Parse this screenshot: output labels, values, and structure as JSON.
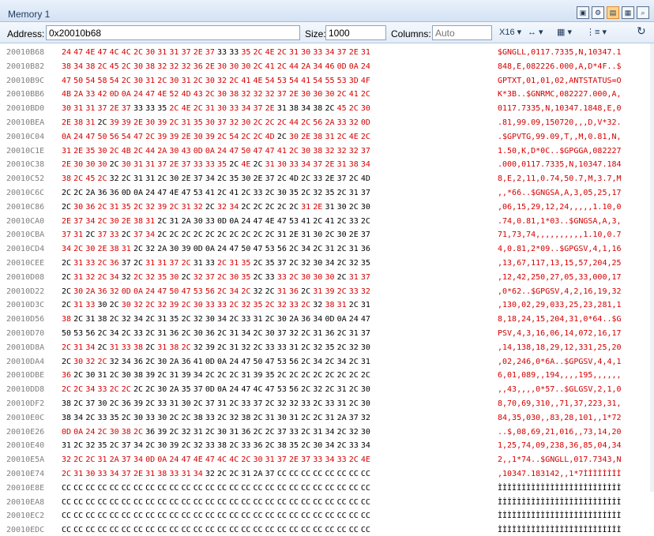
{
  "window": {
    "title": "Memory 1"
  },
  "toolbar": {
    "address_label": "Address:",
    "address_value": "0x20010b68",
    "size_label": "Size:",
    "size_value": "1000",
    "columns_label": "Columns:",
    "columns_placeholder": "Auto",
    "format_label": "X16",
    "colors": {
      "changed": "#d40000",
      "unchanged": "#000000",
      "address": "#808080",
      "active_icon": "#ffd38a"
    }
  },
  "memory": {
    "rows": [
      {
        "address": "20010B68",
        "hex": "24 47 4E 47 4C 4C 2C 30 31 31 37 2E 37 33 33 35 2C 4E 2C 31 30 33 34 37 2E 31",
        "ascii": "$GNGLL,0117.7335,N,10347.1",
        "black": [
          13,
          14
        ]
      },
      {
        "address": "20010B82",
        "hex": "38 34 38 2C 45 2C 30 38 32 32 32 36 2E 30 30 30 2C 41 2C 44 2A 34 46 0D 0A 24",
        "ascii": "848,E,082226.000,A,D*4F..$",
        "black": []
      },
      {
        "address": "20010B9C",
        "hex": "47 50 54 58 54 2C 30 31 2C 30 31 2C 30 32 2C 41 4E 54 53 54 41 54 55 53 3D 4F",
        "ascii": "GPTXT,01,01,02,ANTSTATUS=O",
        "black": []
      },
      {
        "address": "20010BB6",
        "hex": "4B 2A 33 42 0D 0A 24 47 4E 52 4D 43 2C 30 38 32 32 32 37 2E 30 30 30 2C 41 2C",
        "ascii": "K*3B..$GNRMC,082227.000,A,",
        "black": []
      },
      {
        "address": "20010BD0",
        "hex": "30 31 31 37 2E 37 33 33 35 2C 4E 2C 31 30 33 34 37 2E 31 38 34 38 2C 45 2C 30",
        "ascii": "0117.7335,N,10347.1848,E,0",
        "black": [
          6,
          7,
          8,
          18,
          19,
          20,
          21,
          22
        ]
      },
      {
        "address": "20010BEA",
        "hex": "2E 38 31 2C 39 39 2E 30 39 2C 31 35 30 37 32 30 2C 2C 2C 44 2C 56 2A 33 32 0D",
        "ascii": ".81,99.09,150720,,,D,V*32.",
        "black": [
          3
        ]
      },
      {
        "address": "20010C04",
        "hex": "0A 24 47 50 56 54 47 2C 39 39 2E 30 39 2C 54 2C 2C 4D 2C 30 2E 38 31 2C 4E 2C",
        "ascii": ".$GPVTG,99.09,T,,M,0.81,N,",
        "black": [
          18
        ]
      },
      {
        "address": "20010C1E",
        "hex": "31 2E 35 30 2C 4B 2C 44 2A 30 43 0D 0A 24 47 50 47 47 41 2C 30 38 32 32 32 37",
        "ascii": "1.50,K,D*0C..$GPGGA,082227",
        "black": []
      },
      {
        "address": "20010C38",
        "hex": "2E 30 30 30 2C 30 31 31 37 2E 37 33 33 35 2C 4E 2C 31 30 33 34 37 2E 31 38 34",
        "ascii": ".000,0117.7335,N,10347.184",
        "black": [
          4,
          14,
          16
        ]
      },
      {
        "address": "20010C52",
        "hex": "38 2C 45 2C 32 2C 31 31 2C 30 2E 37 34 2C 35 30 2E 37 2C 4D 2C 33 2E 37 2C 4D",
        "ascii": "8,E,2,11,0.74,50.7,M,3.7,M",
        "black": [
          4,
          5,
          6,
          7,
          8,
          9,
          10,
          11,
          12,
          13,
          14,
          15,
          16,
          17,
          18,
          19,
          20,
          21,
          22,
          23,
          24,
          25
        ]
      },
      {
        "address": "20010C6C",
        "hex": "2C 2C 2A 36 36 0D 0A 24 47 4E 47 53 41 2C 41 2C 33 2C 30 35 2C 32 35 2C 31 37",
        "ascii": ",,*66..$GNGSA,A,3,05,25,17",
        "black": [
          0,
          1,
          2,
          3,
          4,
          5,
          6,
          7,
          8,
          9,
          10,
          11,
          12,
          13,
          14,
          15,
          16,
          17,
          18,
          19,
          20,
          21,
          22,
          23,
          24,
          25
        ]
      },
      {
        "address": "20010C86",
        "hex": "2C 30 36 2C 31 35 2C 32 39 2C 31 32 2C 32 34 2C 2C 2C 2C 2C 31 2E 31 30 2C 30",
        "ascii": ",06,15,29,12,24,,,,,1.10,0",
        "black": [
          0,
          12,
          15,
          16,
          17,
          18,
          19,
          22,
          23,
          24,
          25
        ]
      },
      {
        "address": "20010CA0",
        "hex": "2E 37 34 2C 30 2E 38 31 2C 31 2A 30 33 0D 0A 24 47 4E 47 53 41 2C 41 2C 33 2C",
        "ascii": ".74,0.81,1*03..$GNGSA,A,3,",
        "black": [
          8,
          9,
          10,
          11,
          12,
          13,
          14,
          15,
          16,
          17,
          18,
          19,
          20,
          21,
          22,
          23,
          24,
          25
        ]
      },
      {
        "address": "20010CBA",
        "hex": "37 31 2C 37 33 2C 37 34 2C 2C 2C 2C 2C 2C 2C 2C 2C 2C 31 2E 31 30 2C 30 2E 37",
        "ascii": "71,73,74,,,,,,,,,,1.10,0.7",
        "black": [
          2,
          5,
          8,
          9,
          10,
          11,
          12,
          13,
          14,
          15,
          16,
          17,
          18,
          19,
          20,
          21,
          22,
          23,
          24,
          25
        ]
      },
      {
        "address": "20010CD4",
        "hex": "34 2C 30 2E 38 31 2C 32 2A 30 39 0D 0A 24 47 50 47 53 56 2C 34 2C 31 2C 31 36",
        "ascii": "4,0.81,2*09..$GPGSV,4,1,16",
        "black": [
          6,
          7,
          8,
          9,
          10,
          11,
          12,
          13,
          14,
          15,
          16,
          17,
          18,
          19,
          20,
          21,
          22,
          23,
          24,
          25
        ]
      },
      {
        "address": "20010CEE",
        "hex": "2C 31 33 2C 36 37 2C 31 31 37 2C 31 33 2C 31 35 2C 35 37 2C 32 30 34 2C 32 35",
        "ascii": ",13,67,117,13,15,57,204,25",
        "black": [
          0,
          5,
          6,
          11,
          12,
          16,
          17,
          18,
          19,
          20,
          21,
          22,
          23,
          24,
          25
        ]
      },
      {
        "address": "20010D08",
        "hex": "2C 31 32 2C 34 32 2C 32 35 30 2C 32 37 2C 30 35 2C 33 33 2C 30 30 30 2C 31 37",
        "ascii": ",12,42,250,27,05,33,000,17",
        "black": [
          0,
          5,
          10,
          16,
          17,
          23
        ]
      },
      {
        "address": "20010D22",
        "hex": "2C 30 2A 36 32 0D 0A 24 47 50 47 53 56 2C 34 2C 32 2C 31 36 2C 31 39 2C 33 32",
        "ascii": ",0*62..$GPGSV,4,2,16,19,32",
        "black": [
          0,
          16,
          17,
          20
        ]
      },
      {
        "address": "20010D3C",
        "hex": "2C 31 33 30 2C 30 32 2C 32 39 2C 30 33 33 2C 32 35 2C 32 33 2C 32 38 31 2C 31",
        "ascii": ",130,02,29,033,25,23,281,1",
        "black": [
          0,
          3,
          4,
          21,
          24,
          25
        ]
      },
      {
        "address": "20010D56",
        "hex": "38 2C 31 38 2C 32 34 2C 31 35 2C 32 30 34 2C 33 31 2C 30 2A 36 34 0D 0A 24 47",
        "ascii": "8,18,24,15,204,31,0*64..$G",
        "black": [
          1,
          2,
          3,
          4,
          5,
          6,
          7,
          8,
          9,
          10,
          11,
          12,
          13,
          14,
          15,
          16,
          17,
          18,
          19,
          20,
          21,
          22,
          23,
          24,
          25
        ]
      },
      {
        "address": "20010D70",
        "hex": "50 53 56 2C 34 2C 33 2C 31 36 2C 30 36 2C 31 34 2C 30 37 32 2C 31 36 2C 31 37",
        "ascii": "PSV,4,3,16,06,14,072,16,17",
        "black": [
          0,
          1,
          2,
          3,
          4,
          5,
          6,
          7,
          8,
          9,
          10,
          11,
          12,
          13,
          14,
          15,
          16,
          17,
          18,
          19,
          20,
          21,
          22,
          23,
          24,
          25
        ]
      },
      {
        "address": "20010D8A",
        "hex": "2C 31 34 2C 31 33 38 2C 31 38 2C 32 39 2C 31 32 2C 33 33 31 2C 32 35 2C 32 30",
        "ascii": ",14,138,18,29,12,331,25,20",
        "black": [
          3,
          7,
          11,
          12,
          13,
          14,
          15,
          16,
          17,
          18,
          19,
          20,
          21,
          22,
          23,
          24,
          25
        ]
      },
      {
        "address": "20010DA4",
        "hex": "2C 30 32 2C 32 34 36 2C 30 2A 36 41 0D 0A 24 47 50 47 53 56 2C 34 2C 34 2C 31",
        "ascii": ",02,246,0*6A..$GPGSV,4,4,1",
        "black": [
          0,
          4,
          5,
          6,
          7,
          8,
          9,
          10,
          11,
          12,
          13,
          14,
          15,
          16,
          17,
          18,
          19,
          20,
          21,
          22,
          23,
          24,
          25
        ]
      },
      {
        "address": "20010DBE",
        "hex": "36 2C 30 31 2C 30 38 39 2C 31 39 34 2C 2C 2C 31 39 35 2C 2C 2C 2C 2C 2C 2C 2C",
        "ascii": "6,01,089,,194,,,,195,,,,,,",
        "black": [
          1,
          2,
          3,
          4,
          5,
          6,
          7,
          8,
          9,
          10,
          11,
          12,
          13,
          14,
          15,
          16,
          17,
          18,
          19,
          20,
          21,
          22,
          23,
          24,
          25
        ]
      },
      {
        "address": "20010DD8",
        "hex": "2C 2C 34 33 2C 2C 2C 2C 30 2A 35 37 0D 0A 24 47 4C 47 53 56 2C 32 2C 31 2C 30",
        "ascii": ",,43,,,,0*57..$GLGSV,2,1,0",
        "black": [
          6,
          7,
          8,
          9,
          10,
          11,
          12,
          13,
          14,
          15,
          16,
          17,
          18,
          19,
          20,
          21,
          22,
          23,
          24,
          25
        ]
      },
      {
        "address": "20010DF2",
        "hex": "38 2C 37 30 2C 36 39 2C 33 31 30 2C 37 31 2C 33 37 2C 32 32 33 2C 33 31 2C 30",
        "ascii": "8,70,69,310,,71,37,223,31,",
        "black": [
          0,
          1,
          2,
          3,
          4,
          5,
          6,
          7,
          8,
          9,
          10,
          11,
          12,
          13,
          14,
          15,
          16,
          17,
          18,
          19,
          20,
          21,
          22,
          23,
          24,
          25
        ]
      },
      {
        "address": "20010E0C",
        "hex": "38 34 2C 33 35 2C 30 33 30 2C 2C 38 33 2C 32 38 2C 31 30 31 2C 2C 31 2A 37 32",
        "ascii": "84,35,030,,83,28,101,,1*72",
        "black": [
          0,
          1,
          2,
          3,
          4,
          5,
          6,
          7,
          8,
          9,
          10,
          11,
          12,
          13,
          14,
          15,
          16,
          17,
          18,
          19,
          20,
          21,
          22,
          23,
          24,
          25
        ]
      },
      {
        "address": "20010E26",
        "hex": "0D 0A 24 2C 30 38 2C 36 39 2C 32 31 2C 30 31 36 2C 2C 37 33 2C 31 34 2C 32 30",
        "ascii": "..$,08,69,21,016,,73,14,20",
        "black": [
          7,
          8,
          9,
          10,
          11,
          12,
          13,
          14,
          15,
          16,
          17,
          18,
          19,
          20,
          21,
          22,
          23,
          24,
          25
        ]
      },
      {
        "address": "20010E40",
        "hex": "31 2C 32 35 2C 37 34 2C 30 39 2C 32 33 38 2C 33 36 2C 38 35 2C 30 34 2C 33 34",
        "ascii": "1,25,74,09,238,36,85,04,34",
        "black": [
          0,
          1,
          2,
          3,
          4,
          5,
          6,
          7,
          8,
          9,
          10,
          11,
          12,
          13,
          14,
          15,
          16,
          17,
          18,
          19,
          20,
          21,
          22,
          23,
          24,
          25
        ]
      },
      {
        "address": "20010E5A",
        "hex": "32 2C 2C 31 2A 37 34 0D 0A 24 47 4E 47 4C 4C 2C 30 31 37 2E 37 33 34 33 2C 4E",
        "ascii": "2,,1*74..$GNGLL,017.7343,N",
        "black": []
      },
      {
        "address": "20010E74",
        "hex": "2C 31 30 33 34 37 2E 31 38 33 31 34 32 2C 2C 31 2A 37 CC CC CC CC CC CC CC CC",
        "ascii": ",10347.183142,,1*7ÌÌÌÌÌÌÌÌ",
        "black": [
          12,
          13,
          14,
          15,
          16,
          17,
          18,
          19,
          20,
          21,
          22,
          23,
          24,
          25
        ]
      },
      {
        "address": "20010E8E",
        "hex": "CC CC CC CC CC CC CC CC CC CC CC CC CC CC CC CC CC CC CC CC CC CC CC CC CC CC",
        "ascii": "ÌÌÌÌÌÌÌÌÌÌÌÌÌÌÌÌÌÌÌÌÌÌÌÌÌÌ",
        "black": "all"
      },
      {
        "address": "20010EA8",
        "hex": "CC CC CC CC CC CC CC CC CC CC CC CC CC CC CC CC CC CC CC CC CC CC CC CC CC CC",
        "ascii": "ÌÌÌÌÌÌÌÌÌÌÌÌÌÌÌÌÌÌÌÌÌÌÌÌÌÌ",
        "black": "all"
      },
      {
        "address": "20010EC2",
        "hex": "CC CC CC CC CC CC CC CC CC CC CC CC CC CC CC CC CC CC CC CC CC CC CC CC CC CC",
        "ascii": "ÌÌÌÌÌÌÌÌÌÌÌÌÌÌÌÌÌÌÌÌÌÌÌÌÌÌ",
        "black": "all"
      },
      {
        "address": "20010EDC",
        "hex": "CC CC CC CC CC CC CC CC CC CC CC CC CC CC CC CC CC CC CC CC CC CC CC CC CC CC",
        "ascii": "ÌÌÌÌÌÌÌÌÌÌÌÌÌÌÌÌÌÌÌÌÌÌÌÌÌÌ",
        "black": "all"
      }
    ]
  }
}
